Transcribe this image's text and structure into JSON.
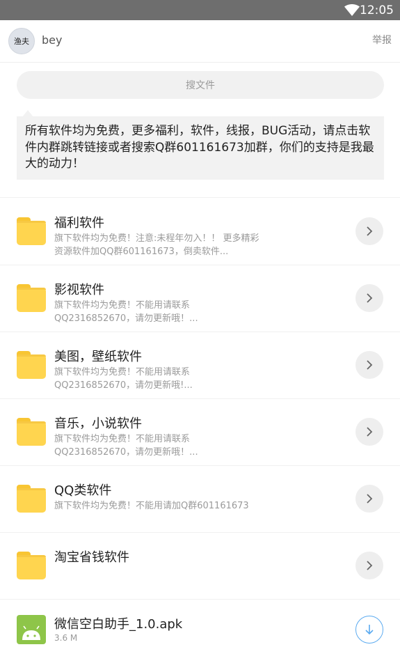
{
  "status_bar": {
    "time": "12:05",
    "wifi_icon": "wifi-icon"
  },
  "header": {
    "avatar_text": "渔夫",
    "username": "bey",
    "report_label": "举报"
  },
  "search": {
    "placeholder": "搜文件"
  },
  "notice": {
    "text": "所有软件均为免费，更多福利，软件，线报，BUG活动，请点击软件内群跳转链接或者搜索Q群601161673加群，你们的支持是我最大的动力！"
  },
  "folders": [
    {
      "title": "福利软件",
      "desc": "旗下软件均为免费！注意:未程年勿入！！ 更多精彩资源软件加QQ群601161673，倒卖软件..."
    },
    {
      "title": "影视软件",
      "desc": "旗下软件均为免费！不能用请联系QQ2316852670，请勿更新哦！..."
    },
    {
      "title": "美图，壁纸软件",
      "desc": "旗下软件均为免费！不能用请联系QQ2316852670，请勿更新哦!..."
    },
    {
      "title": "音乐，小说软件",
      "desc": "旗下软件均为免费！不能用请联系QQ2316852670，请勿更新哦！..."
    },
    {
      "title": "QQ类软件",
      "desc": "旗下软件均为免费！不能用请加Q群601161673"
    },
    {
      "title": "淘宝省钱软件",
      "desc": ""
    }
  ],
  "file": {
    "name": "微信空白助手_1.0.apk",
    "size": "3.6 M"
  },
  "colors": {
    "folder": "#ffd54f",
    "apk": "#8ec549",
    "download": "#5aaaf0",
    "status_bar": "#6e6e6e"
  }
}
